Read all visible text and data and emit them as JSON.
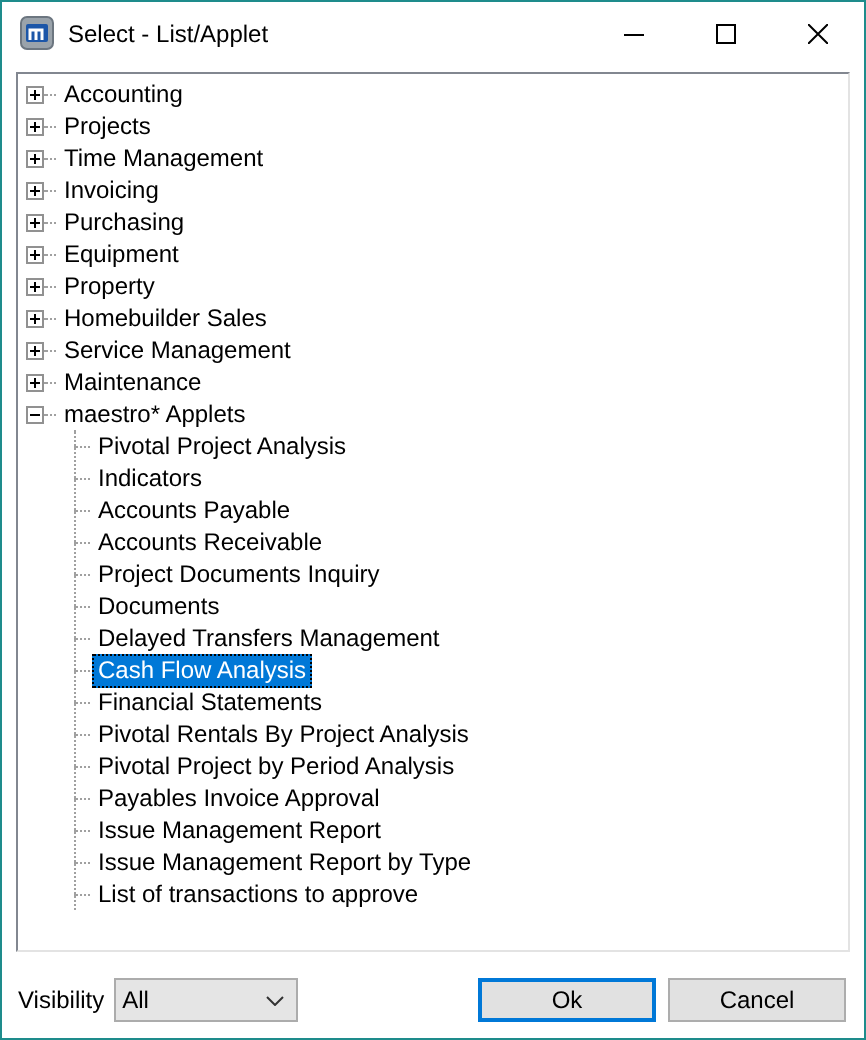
{
  "window": {
    "title": "Select - List/Applet"
  },
  "tree": [
    {
      "label": "Accounting",
      "expanded": false
    },
    {
      "label": "Projects",
      "expanded": false
    },
    {
      "label": "Time Management",
      "expanded": false
    },
    {
      "label": "Invoicing",
      "expanded": false
    },
    {
      "label": "Purchasing",
      "expanded": false
    },
    {
      "label": "Equipment",
      "expanded": false
    },
    {
      "label": "Property",
      "expanded": false
    },
    {
      "label": "Homebuilder Sales",
      "expanded": false
    },
    {
      "label": "Service Management",
      "expanded": false
    },
    {
      "label": "Maintenance",
      "expanded": false
    },
    {
      "label": "maestro* Applets",
      "expanded": true,
      "children": [
        {
          "label": "Pivotal Project Analysis",
          "selected": false
        },
        {
          "label": "Indicators",
          "selected": false
        },
        {
          "label": "Accounts Payable",
          "selected": false
        },
        {
          "label": "Accounts Receivable",
          "selected": false
        },
        {
          "label": "Project Documents Inquiry",
          "selected": false
        },
        {
          "label": "Documents",
          "selected": false
        },
        {
          "label": "Delayed Transfers Management",
          "selected": false
        },
        {
          "label": "Cash Flow Analysis",
          "selected": true
        },
        {
          "label": "Financial Statements",
          "selected": false
        },
        {
          "label": "Pivotal Rentals By Project Analysis",
          "selected": false
        },
        {
          "label": "Pivotal Project by Period Analysis",
          "selected": false
        },
        {
          "label": "Payables Invoice Approval",
          "selected": false
        },
        {
          "label": "Issue Management Report",
          "selected": false
        },
        {
          "label": "Issue Management Report by Type",
          "selected": false
        },
        {
          "label": "List of transactions to approve",
          "selected": false
        }
      ]
    }
  ],
  "visibility": {
    "label": "Visibility",
    "value": "All"
  },
  "buttons": [
    {
      "label": "Ok",
      "default": true
    },
    {
      "label": "Cancel",
      "default": false
    }
  ]
}
